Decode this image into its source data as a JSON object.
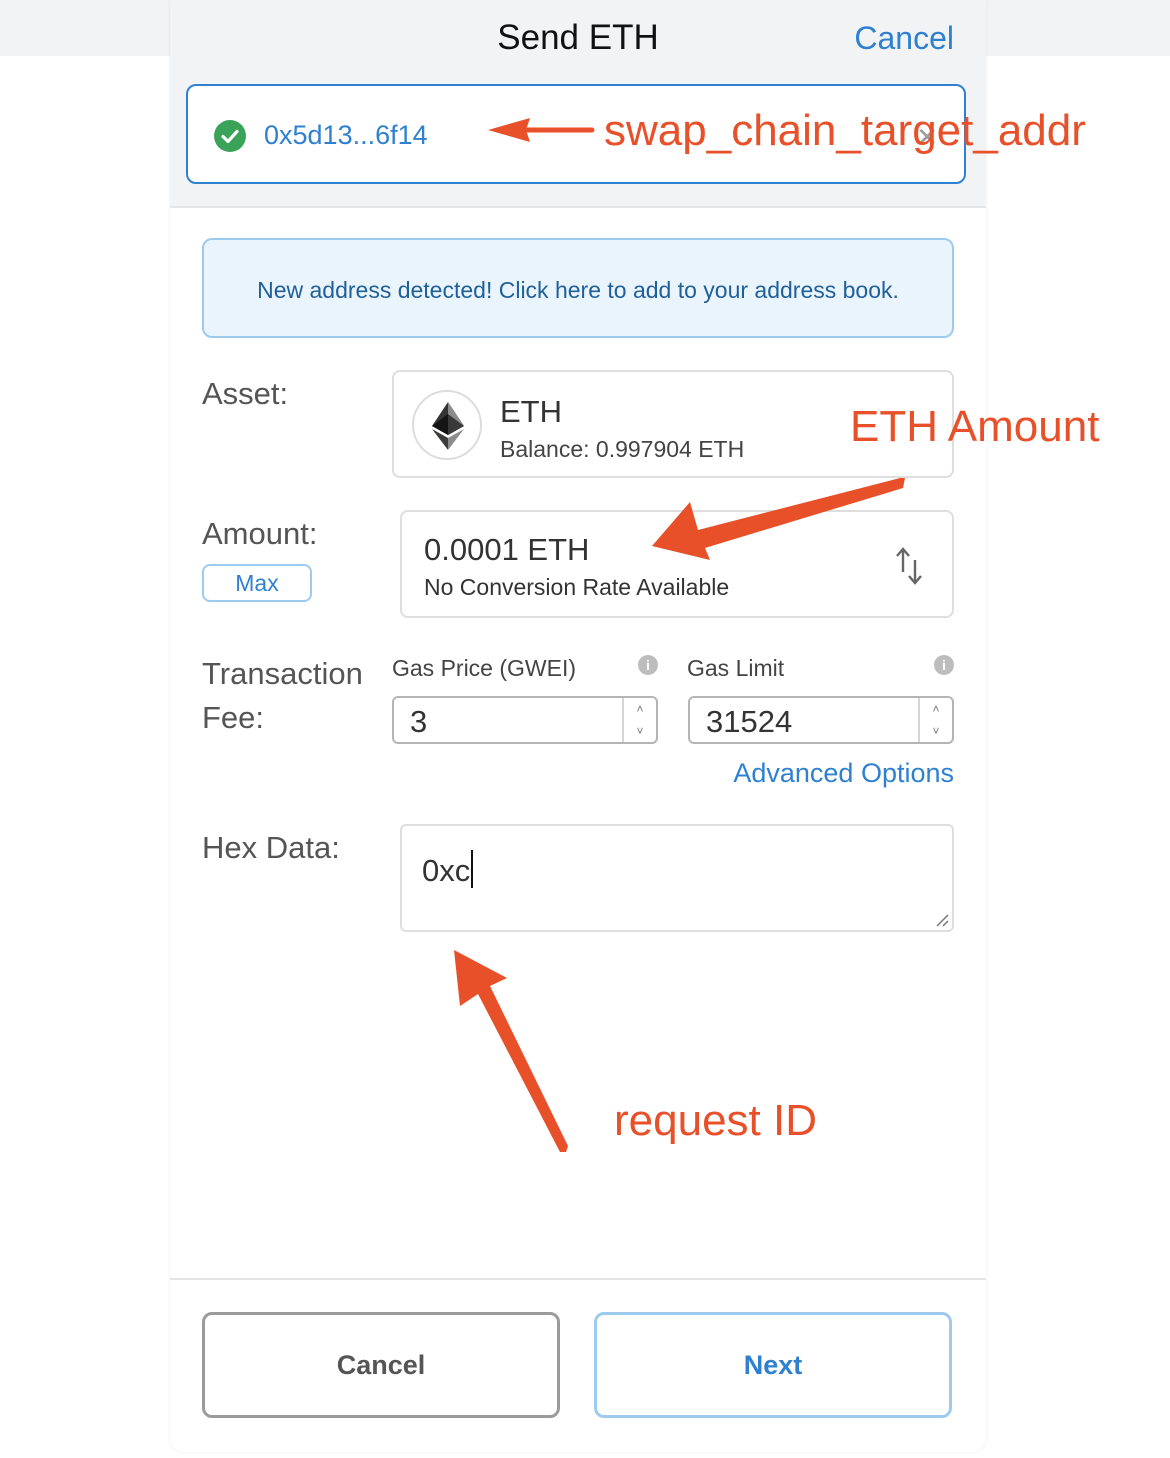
{
  "header": {
    "title": "Send ETH",
    "cancel_label": "Cancel"
  },
  "recipient": {
    "address": "0x5d13...6f14",
    "clear_glyph": "✕"
  },
  "notice": {
    "text": "New address detected! Click here to add to your address book."
  },
  "asset": {
    "label": "Asset:",
    "symbol": "ETH",
    "balance": "Balance: 0.997904 ETH",
    "icon": "ethereum-icon"
  },
  "amount": {
    "label": "Amount:",
    "max_label": "Max",
    "value": "0.0001  ETH",
    "conversion": "No Conversion Rate Available"
  },
  "fee": {
    "label_line1": "Transaction",
    "label_line2": "Fee:",
    "gas_price_label": "Gas Price (GWEI)",
    "gas_price_value": "3",
    "gas_limit_label": "Gas Limit",
    "gas_limit_value": "31524",
    "advanced_label": "Advanced Options",
    "info_glyph": "i",
    "spin_up": "˄",
    "spin_down": "˅"
  },
  "hex": {
    "label": "Hex Data:",
    "value": "0xc"
  },
  "footer": {
    "cancel_label": "Cancel",
    "next_label": "Next"
  },
  "annotations": {
    "recipient_note": "swap_chain_target_addr",
    "amount_note": "ETH Amount",
    "hex_note": "request ID",
    "color": "#e8502a"
  },
  "colors": {
    "accent": "#2f80d1",
    "success": "#3aa35a",
    "header_bg": "#f2f3f4"
  }
}
